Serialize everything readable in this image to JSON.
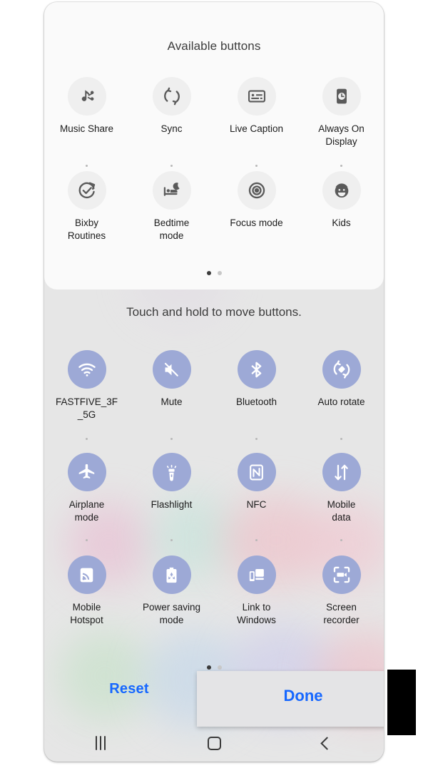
{
  "available_panel": {
    "title": "Available buttons",
    "rows": [
      [
        {
          "label": "Music Share",
          "icon": "music-share-icon"
        },
        {
          "label": "Sync",
          "icon": "sync-icon"
        },
        {
          "label": "Live Caption",
          "icon": "live-caption-icon"
        },
        {
          "label": "Always On\nDisplay",
          "icon": "always-on-display-icon"
        }
      ],
      [
        {
          "label": "Bixby\nRoutines",
          "icon": "bixby-routines-icon"
        },
        {
          "label": "Bedtime\nmode",
          "icon": "bedtime-mode-icon"
        },
        {
          "label": "Focus mode",
          "icon": "focus-mode-icon"
        },
        {
          "label": "Kids",
          "icon": "kids-icon"
        }
      ]
    ],
    "page_dots": {
      "count": 2,
      "active_index": 0
    }
  },
  "active_panel": {
    "hint": "Touch and hold to move buttons.",
    "rows": [
      [
        {
          "label": "FASTFIVE_3F\n_5G",
          "icon": "wifi-icon"
        },
        {
          "label": "Mute",
          "icon": "mute-icon"
        },
        {
          "label": "Bluetooth",
          "icon": "bluetooth-icon"
        },
        {
          "label": "Auto rotate",
          "icon": "auto-rotate-icon"
        }
      ],
      [
        {
          "label": "Airplane\nmode",
          "icon": "airplane-mode-icon"
        },
        {
          "label": "Flashlight",
          "icon": "flashlight-icon"
        },
        {
          "label": "NFC",
          "icon": "nfc-icon"
        },
        {
          "label": "Mobile\ndata",
          "icon": "mobile-data-icon"
        }
      ],
      [
        {
          "label": "Mobile\nHotspot",
          "icon": "mobile-hotspot-icon"
        },
        {
          "label": "Power saving\nmode",
          "icon": "power-saving-mode-icon"
        },
        {
          "label": "Link to\nWindows",
          "icon": "link-to-windows-icon"
        },
        {
          "label": "Screen\nrecorder",
          "icon": "screen-recorder-icon"
        }
      ]
    ],
    "page_dots": {
      "count": 2,
      "active_index": 0
    }
  },
  "footer": {
    "reset_label": "Reset",
    "done_label": "Done"
  },
  "navbar": {
    "recents_label": "recents-icon",
    "home_label": "home-icon",
    "back_label": "back-icon"
  },
  "colors": {
    "accent_blue": "#1667ff",
    "active_circle": "#9da9d6",
    "available_circle": "#efefef",
    "icon_gray": "#5a5a5a",
    "card_bg": "#e6e6e6",
    "panel_bg": "#fafafa",
    "highlight_box": "#000000"
  }
}
